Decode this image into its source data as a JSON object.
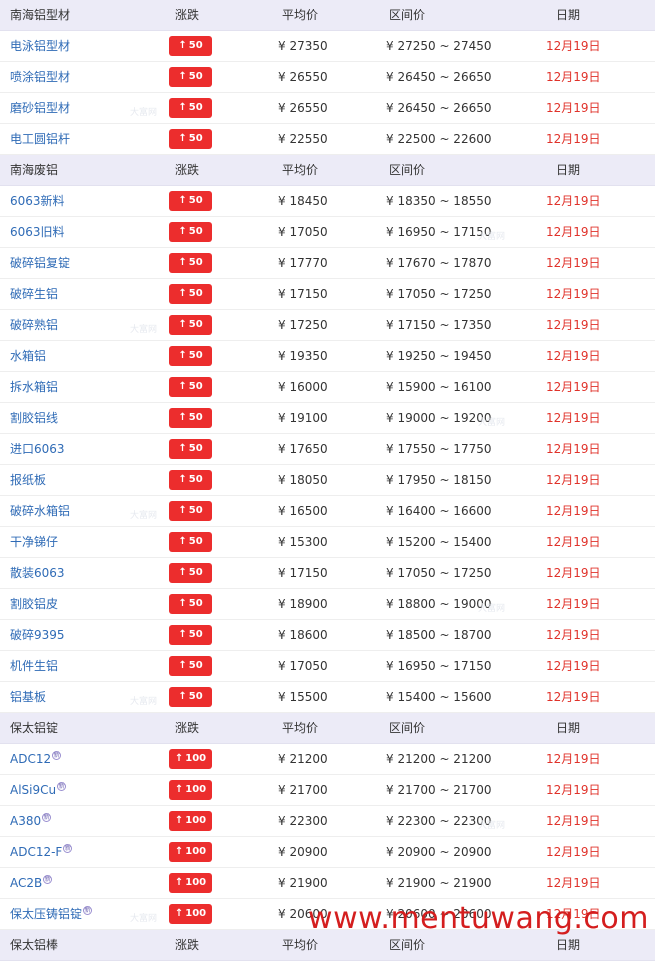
{
  "sections": [
    {
      "header": {
        "name": "南海铝型材",
        "change": "涨跌",
        "avg": "平均价",
        "range": "区间价",
        "date": "日期"
      },
      "rows": [
        {
          "name": "电泳铝型材",
          "change": "50",
          "avg": "¥ 27350",
          "range": "¥ 27250 ~ 27450",
          "date": "12月19日"
        },
        {
          "name": "喷涂铝型材",
          "change": "50",
          "avg": "¥ 26550",
          "range": "¥ 26450 ~ 26650",
          "date": "12月19日"
        },
        {
          "name": "磨砂铝型材",
          "change": "50",
          "avg": "¥ 26550",
          "range": "¥ 26450 ~ 26650",
          "date": "12月19日"
        },
        {
          "name": "电工圆铝杆",
          "change": "50",
          "avg": "¥ 22550",
          "range": "¥ 22500 ~ 22600",
          "date": "12月19日"
        }
      ]
    },
    {
      "header": {
        "name": "南海废铝",
        "change": "涨跌",
        "avg": "平均价",
        "range": "区间价",
        "date": "日期"
      },
      "rows": [
        {
          "name": "6063新料",
          "change": "50",
          "avg": "¥ 18450",
          "range": "¥ 18350 ~ 18550",
          "date": "12月19日"
        },
        {
          "name": "6063旧料",
          "change": "50",
          "avg": "¥ 17050",
          "range": "¥ 16950 ~ 17150",
          "date": "12月19日"
        },
        {
          "name": "破碎铝复锭",
          "change": "50",
          "avg": "¥ 17770",
          "range": "¥ 17670 ~ 17870",
          "date": "12月19日"
        },
        {
          "name": "破碎生铝",
          "change": "50",
          "avg": "¥ 17150",
          "range": "¥ 17050 ~ 17250",
          "date": "12月19日"
        },
        {
          "name": "破碎熟铝",
          "change": "50",
          "avg": "¥ 17250",
          "range": "¥ 17150 ~ 17350",
          "date": "12月19日"
        },
        {
          "name": "水箱铝",
          "change": "50",
          "avg": "¥ 19350",
          "range": "¥ 19250 ~ 19450",
          "date": "12月19日"
        },
        {
          "name": "拆水箱铝",
          "change": "50",
          "avg": "¥ 16000",
          "range": "¥ 15900 ~ 16100",
          "date": "12月19日"
        },
        {
          "name": "割胶铝线",
          "change": "50",
          "avg": "¥ 19100",
          "range": "¥ 19000 ~ 19200",
          "date": "12月19日"
        },
        {
          "name": "进口6063",
          "change": "50",
          "avg": "¥ 17650",
          "range": "¥ 17550 ~ 17750",
          "date": "12月19日"
        },
        {
          "name": "报纸板",
          "change": "50",
          "avg": "¥ 18050",
          "range": "¥ 17950 ~ 18150",
          "date": "12月19日"
        },
        {
          "name": "破碎水箱铝",
          "change": "50",
          "avg": "¥ 16500",
          "range": "¥ 16400 ~ 16600",
          "date": "12月19日"
        },
        {
          "name": "干净锑仔",
          "change": "50",
          "avg": "¥ 15300",
          "range": "¥ 15200 ~ 15400",
          "date": "12月19日"
        },
        {
          "name": "散装6063",
          "change": "50",
          "avg": "¥ 17150",
          "range": "¥ 17050 ~ 17250",
          "date": "12月19日"
        },
        {
          "name": "割胶铝皮",
          "change": "50",
          "avg": "¥ 18900",
          "range": "¥ 18800 ~ 19000",
          "date": "12月19日"
        },
        {
          "name": "破碎9395",
          "change": "50",
          "avg": "¥ 18600",
          "range": "¥ 18500 ~ 18700",
          "date": "12月19日"
        },
        {
          "name": "机件生铝",
          "change": "50",
          "avg": "¥ 17050",
          "range": "¥ 16950 ~ 17150",
          "date": "12月19日"
        },
        {
          "name": "铝基板",
          "change": "50",
          "avg": "¥ 15500",
          "range": "¥ 15400 ~ 15600",
          "date": "12月19日"
        }
      ]
    },
    {
      "header": {
        "name": "保太铝锭",
        "change": "涨跌",
        "avg": "平均价",
        "range": "区间价",
        "date": "日期"
      },
      "rows": [
        {
          "name": "ADC12",
          "tag": "新",
          "change": "100",
          "avg": "¥ 21200",
          "range": "¥ 21200 ~ 21200",
          "date": "12月19日"
        },
        {
          "name": "AlSi9Cu",
          "tag": "新",
          "change": "100",
          "avg": "¥ 21700",
          "range": "¥ 21700 ~ 21700",
          "date": "12月19日"
        },
        {
          "name": "A380",
          "tag": "新",
          "change": "100",
          "avg": "¥ 22300",
          "range": "¥ 22300 ~ 22300",
          "date": "12月19日"
        },
        {
          "name": "ADC12-F",
          "tag": "新",
          "change": "100",
          "avg": "¥ 20900",
          "range": "¥ 20900 ~ 20900",
          "date": "12月19日"
        },
        {
          "name": "AC2B",
          "tag": "新",
          "change": "100",
          "avg": "¥ 21900",
          "range": "¥ 21900 ~ 21900",
          "date": "12月19日"
        },
        {
          "name": "保太压铸铝锭",
          "tag": "新",
          "change": "100",
          "avg": "¥ 20600",
          "range": "¥ 20600 ~ 20600",
          "date": "12月19日"
        }
      ]
    },
    {
      "header": {
        "name": "保太铝棒",
        "change": "涨跌",
        "avg": "平均价",
        "range": "区间价",
        "date": "日期"
      },
      "rows": []
    }
  ],
  "change_arrow": "↑",
  "watermark": "大富网",
  "site_watermark": "www.mentuwang.com",
  "colors": {
    "header_bg": "#ecebf7",
    "link": "#2f6bb6",
    "badge": "#ec2d2d",
    "date": "#e0322a"
  }
}
